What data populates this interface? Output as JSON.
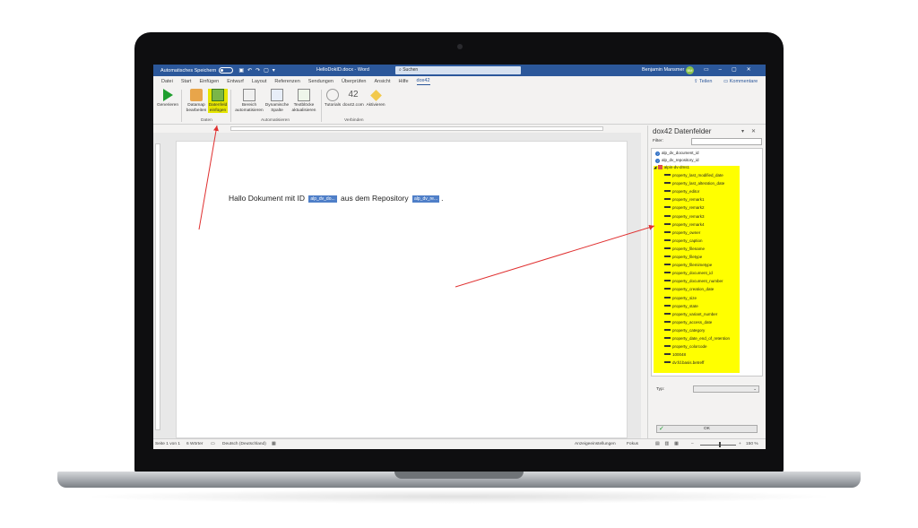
{
  "window": {
    "autosave_label": "Automatisches Speichern",
    "doc_title": "HelloDokID.docx - Word",
    "search_placeholder": "Suchen",
    "user_name": "Benjamin Mansmer",
    "user_initials": "BM"
  },
  "menu": {
    "items": [
      "Datei",
      "Start",
      "Einfügen",
      "Entwurf",
      "Layout",
      "Referenzen",
      "Sendungen",
      "Überprüfen",
      "Ansicht",
      "Hilfe",
      "dox42"
    ],
    "active": "dox42",
    "share_label": "Teilen",
    "comments_label": "Kommentare"
  },
  "ribbon": {
    "buttons": [
      {
        "label": "Generieren"
      },
      {
        "label": "Datamap bearbeiten"
      },
      {
        "label": "Datenfeld einfügen"
      },
      {
        "label": "Bereich automatisieren"
      },
      {
        "label": "Dynamische Spalte"
      },
      {
        "label": "Textblöcke aktualisieren"
      },
      {
        "label": "Tutorials"
      },
      {
        "label": "dox42.com"
      },
      {
        "label": "Aktivieren"
      }
    ],
    "groups": [
      "Daten",
      "Automatisieren",
      "Verbinden"
    ]
  },
  "document": {
    "text_before": "Hallo Dokument mit ID",
    "field1": "alp_dv_do...",
    "text_middle": "aus dem Repository",
    "field2": "alp_dv_re...",
    "text_after": "."
  },
  "pane": {
    "title": "dox42 Datenfelder",
    "filter_label": "Filter:",
    "top_items": [
      "alp_dv_document_id",
      "alp_dv_repository_id"
    ],
    "folder": "alpin-dv-dms1",
    "properties": [
      "property_last_modified_date",
      "property_last_alteration_date",
      "property_editor",
      "property_remark1",
      "property_remark2",
      "property_remark3",
      "property_remark4",
      "property_owner",
      "property_caption",
      "property_filename",
      "property_filetype",
      "property_filemimetype",
      "property_document_id",
      "property_document_number",
      "property_creation_date",
      "property_size",
      "property_state",
      "property_variant_number",
      "property_access_date",
      "property_category",
      "property_date_end_of_retention",
      "property_colorcode",
      "100048",
      "dv:fd.basis.betreff"
    ],
    "type_label": "Typ:",
    "ok_label": "OK"
  },
  "statusbar": {
    "page": "Seite 1 von 1",
    "words": "6 Wörter",
    "language": "Deutsch (Deutschland)",
    "display_settings": "Anzeigeeinstellungen",
    "focus": "Fokus",
    "zoom": "150 %"
  },
  "colors": {
    "titlebar": "#2b579a",
    "highlight": "#ffff00",
    "field": "#4f7fc8",
    "arrow": "#e03030"
  }
}
